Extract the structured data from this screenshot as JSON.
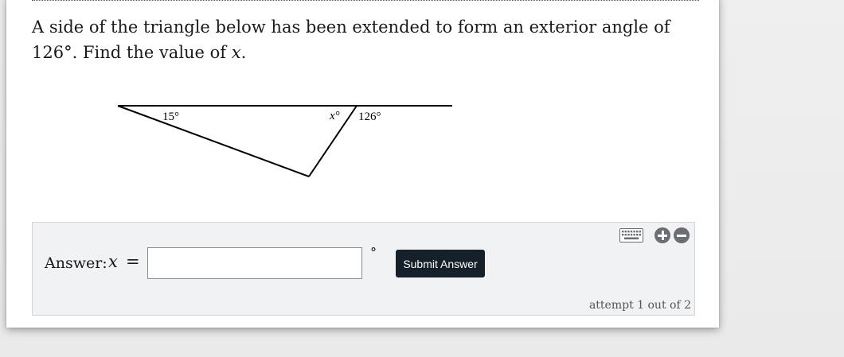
{
  "question": {
    "text_before_var": "A side of the triangle below has been extended to form an exterior angle of 126°. Find the value of ",
    "variable": "x",
    "text_after_var": "."
  },
  "figure": {
    "angle_left_label": "15°",
    "angle_x_label": "x°",
    "angle_exterior_label": "126°"
  },
  "answer": {
    "label": "Answer:",
    "variable": "x",
    "equals": "=",
    "input_value": "",
    "unit": "°",
    "submit_label": "Submit Answer",
    "attempt_text": "attempt 1 out of 2"
  },
  "tools": {
    "icons": [
      "keyboard-icon",
      "zoom-in-icon",
      "zoom-out-icon"
    ]
  }
}
